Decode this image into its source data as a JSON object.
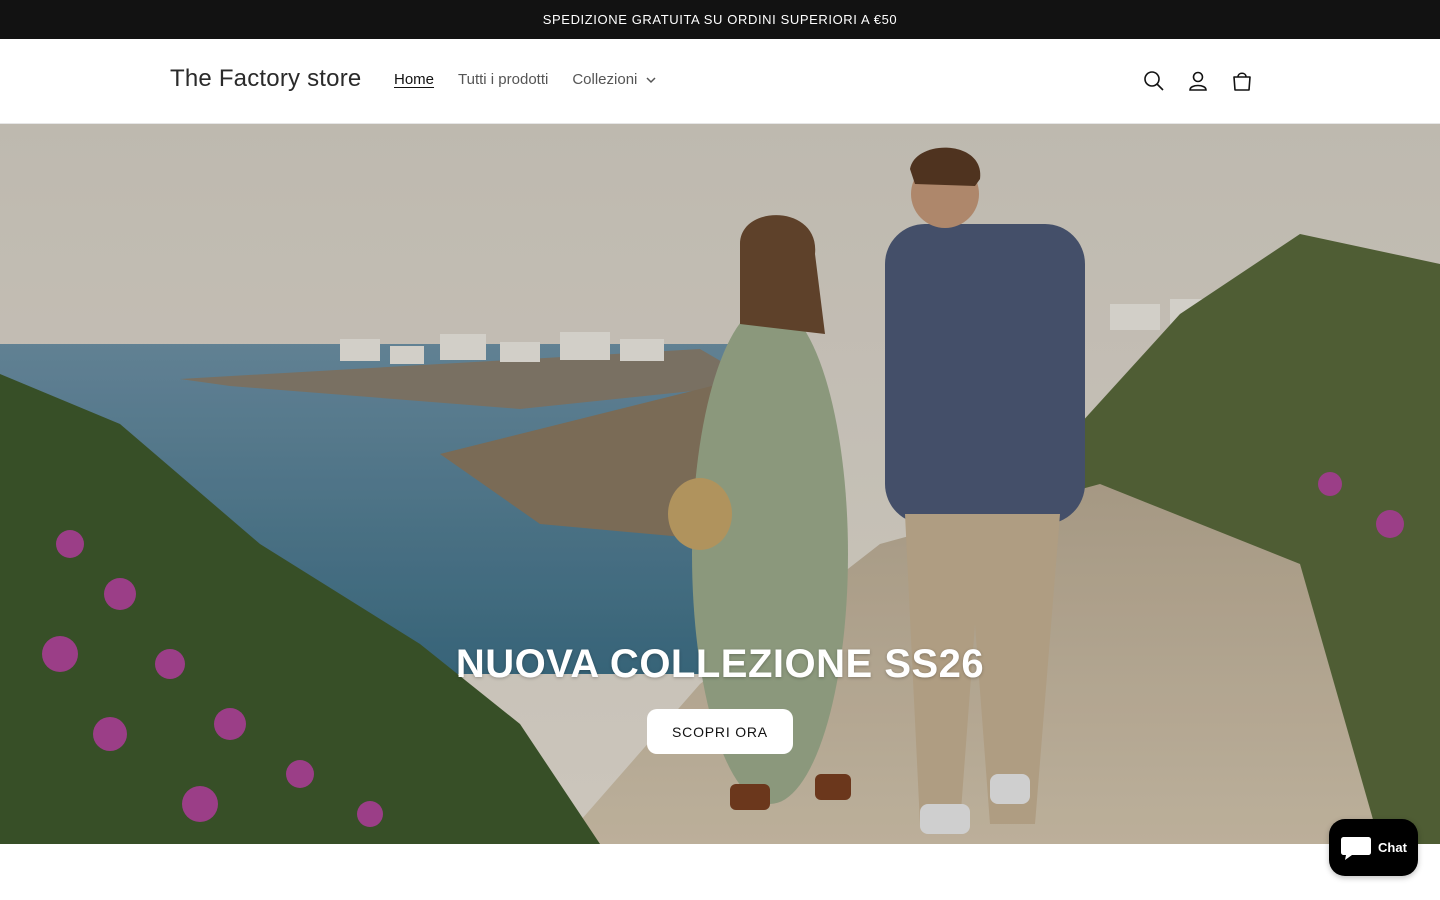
{
  "announcement": {
    "text": "SPEDIZIONE GRATUITA SU ORDINI SUPERIORI A €50"
  },
  "header": {
    "logo": "The Factory store",
    "nav": [
      {
        "label": "Home",
        "active": true
      },
      {
        "label": "Tutti i prodotti",
        "active": false
      },
      {
        "label": "Collezioni",
        "active": false,
        "has_dropdown": true
      }
    ],
    "icons": [
      "search-icon",
      "account-icon",
      "cart-icon"
    ]
  },
  "hero": {
    "title": "NUOVA COLLEZIONE SS26",
    "button_label": "SCOPRI ORA",
    "image_description_icon": "hero-image"
  },
  "chat": {
    "label": "Chat",
    "icon": "chat-bubble-icon"
  },
  "colors": {
    "announcement_bg": "#121212",
    "text": "#121212",
    "chat_bg": "#000000"
  }
}
